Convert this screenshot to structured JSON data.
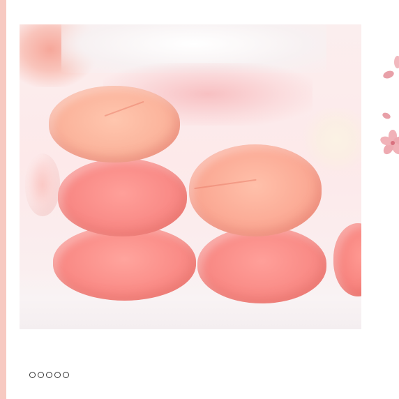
{
  "product_image": {
    "subject": "peach-gummy-candy",
    "colors": {
      "accent_strip": "#f7c9c1",
      "gummy_peach": "#fbb49c",
      "gummy_pink": "#f98a86",
      "petal": "#e8a0a8"
    }
  },
  "decorations": {
    "icons": [
      "sakura-petal-icon",
      "sakura-flower-icon"
    ]
  },
  "carousel": {
    "total_slides": 5,
    "active_index": 0
  }
}
